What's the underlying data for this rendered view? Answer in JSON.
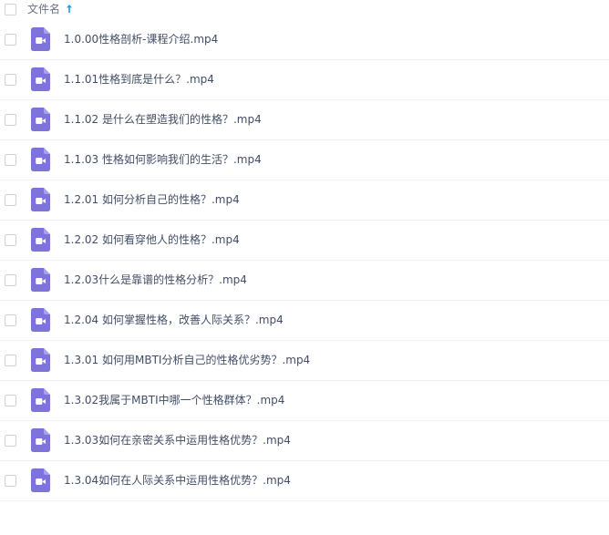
{
  "header": {
    "column_label": "文件名",
    "sort_icon": "arrow-up-icon",
    "accent_color": "#1d9bf0"
  },
  "file_icon": {
    "name": "video-file-icon",
    "color": "#7d73d9"
  },
  "files": [
    {
      "name": "1.0.00性格剖析-课程介绍.mp4"
    },
    {
      "name": "1.1.01性格到底是什么？.mp4"
    },
    {
      "name": "1.1.02 是什么在塑造我们的性格？.mp4"
    },
    {
      "name": "1.1.03 性格如何影响我们的生活？.mp4"
    },
    {
      "name": "1.2.01 如何分析自己的性格？.mp4"
    },
    {
      "name": "1.2.02 如何看穿他人的性格？.mp4"
    },
    {
      "name": "1.2.03什么是靠谱的性格分析？.mp4"
    },
    {
      "name": "1.2.04 如何掌握性格，改善人际关系？.mp4"
    },
    {
      "name": "1.3.01 如何用MBTI分析自己的性格优劣势？.mp4"
    },
    {
      "name": "1.3.02我属于MBTI中哪一个性格群体？.mp4"
    },
    {
      "name": "1.3.03如何在亲密关系中运用性格优势？.mp4"
    },
    {
      "name": "1.3.04如何在人际关系中运用性格优势？.mp4"
    }
  ]
}
